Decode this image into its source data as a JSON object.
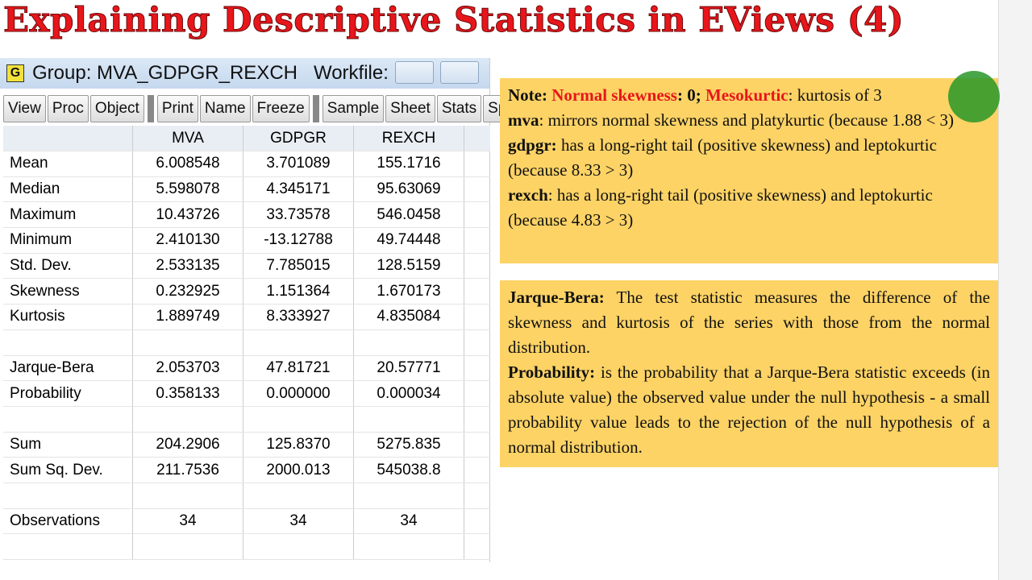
{
  "title": "Explaining Descriptive Statistics in EViews (4)",
  "window": {
    "icon": "G",
    "title": "Group: MVA_GDPGR_REXCH   Workfile: ...",
    "toolbar": [
      [
        "View",
        "Proc",
        "Object"
      ],
      [
        "Print",
        "Name",
        "Freeze"
      ],
      [
        "Sample",
        "Sheet",
        "Stats",
        "Spec"
      ]
    ],
    "columns": [
      "",
      "MVA",
      "GDPGR",
      "REXCH"
    ],
    "rows": [
      [
        "Mean",
        "6.008548",
        "3.701089",
        "155.1716"
      ],
      [
        "Median",
        "5.598078",
        "4.345171",
        "95.63069"
      ],
      [
        "Maximum",
        "10.43726",
        "33.73578",
        "546.0458"
      ],
      [
        "Minimum",
        "2.410130",
        "-13.12788",
        "49.74448"
      ],
      [
        "Std. Dev.",
        "2.533135",
        "7.785015",
        "128.5159"
      ],
      [
        "Skewness",
        "0.232925",
        "1.151364",
        "1.670173"
      ],
      [
        "Kurtosis",
        "1.889749",
        "8.333927",
        "4.835084"
      ],
      [
        "",
        "",
        "",
        ""
      ],
      [
        "Jarque-Bera",
        "2.053703",
        "47.81721",
        "20.57771"
      ],
      [
        "Probability",
        "0.358133",
        "0.000000",
        "0.000034"
      ],
      [
        "",
        "",
        "",
        ""
      ],
      [
        "Sum",
        "204.2906",
        "125.8370",
        "5275.835"
      ],
      [
        "Sum Sq. Dev.",
        "211.7536",
        "2000.013",
        "545038.8"
      ],
      [
        "",
        "",
        "",
        ""
      ],
      [
        "Observations",
        "34",
        "34",
        "34"
      ],
      [
        "",
        "",
        "",
        ""
      ]
    ]
  },
  "note": {
    "l1": [
      "Note: ",
      "Normal skewness",
      ": 0; ",
      "Mesokurtic",
      ": kurtosis of 3"
    ],
    "mva": [
      "mva",
      ": mirrors normal skewness and platykurtic (because 1.88 < 3)"
    ],
    "gdpgr": [
      "gdpgr:",
      " has a long-right tail (positive skewness) and leptokurtic (because 8.33 > 3)"
    ],
    "rexch": [
      "rexch",
      ": has a long-right tail (positive skewness) and leptokurtic (because 4.83 > 3)"
    ]
  },
  "jb": {
    "label": "Jarque-Bera:",
    "text": " The test statistic measures the difference of the skewness and kurtosis of the series with those from the normal distribution.",
    "plabel": "Probability:",
    "ptext": " is the probability that a Jarque-Bera statistic exceeds (in absolute value) the observed value under the null hypothesis - a small probability value leads to the rejection of the null hypothesis of a normal distribution."
  }
}
